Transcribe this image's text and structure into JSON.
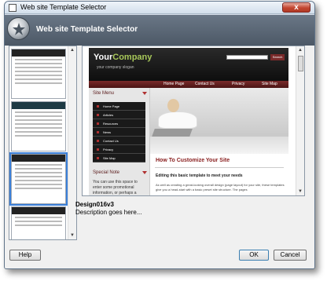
{
  "window": {
    "title": "Web site Template Selector",
    "close_symbol": "x"
  },
  "header": {
    "title": "Web site Template Selector",
    "icon": "template-selector-logo-icon"
  },
  "scroll_arrows": {
    "up": "▲",
    "down": "▼"
  },
  "preview": {
    "company_plain": "Your",
    "company_accent": "Company",
    "slogan": "your company slogan",
    "search_label": "Search",
    "nav": [
      "Home Page",
      "Contact Us",
      "Privacy",
      "Site Map"
    ],
    "side_menu_title": "Site Menu",
    "side_menu_items": [
      "Home Page",
      "Articles",
      "Resources",
      "News",
      "Contact Us",
      "Privacy",
      "Site Map"
    ],
    "special_note_title": "Special Note",
    "special_note_text": "You can use this space to enter some promotional information, or perhaps a",
    "content_title": "How To Customize Your Site",
    "content_subtitle": "Editing this basic template to meet your needs",
    "content_text": "As well as creating a great-looking overall design (page layout) for your site, these templates give you a head-start with a basic preset site structure. The pages"
  },
  "selected_template": {
    "name": "Design016v3",
    "description": "Description goes here..."
  },
  "buttons": {
    "help": "Help",
    "ok": "OK",
    "cancel": "Cancel"
  }
}
